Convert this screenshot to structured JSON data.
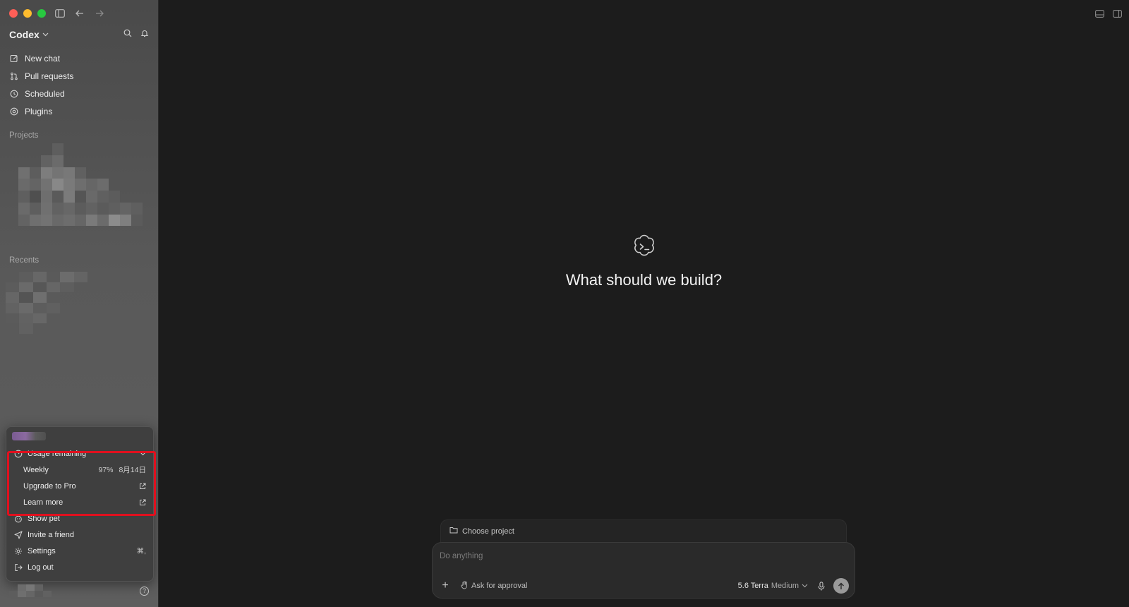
{
  "app": {
    "title": "Codex"
  },
  "sidebar": {
    "nav": [
      {
        "label": "New chat",
        "icon": "edit-icon"
      },
      {
        "label": "Pull requests",
        "icon": "pull-request-icon"
      },
      {
        "label": "Scheduled",
        "icon": "clock-icon"
      },
      {
        "label": "Plugins",
        "icon": "plugin-icon"
      }
    ],
    "projects_label": "Projects",
    "recents_label": "Recents"
  },
  "menu": {
    "usage_label": "Usage remaining",
    "weekly_label": "Weekly",
    "weekly_percent": "97%",
    "weekly_reset": "8月14日",
    "upgrade_label": "Upgrade to Pro",
    "learn_more_label": "Learn more",
    "show_pet_label": "Show pet",
    "invite_label": "Invite a friend",
    "settings_label": "Settings",
    "settings_shortcut": "⌘,",
    "logout_label": "Log out"
  },
  "main": {
    "headline": "What should we build?",
    "choose_project": "Choose project",
    "prompt_placeholder": "Do anything",
    "approval_label": "Ask for approval",
    "model_name": "5.6 Terra",
    "model_effort": "Medium"
  },
  "colors": {
    "highlight": "#e0101e",
    "background": "#1c1c1c"
  }
}
